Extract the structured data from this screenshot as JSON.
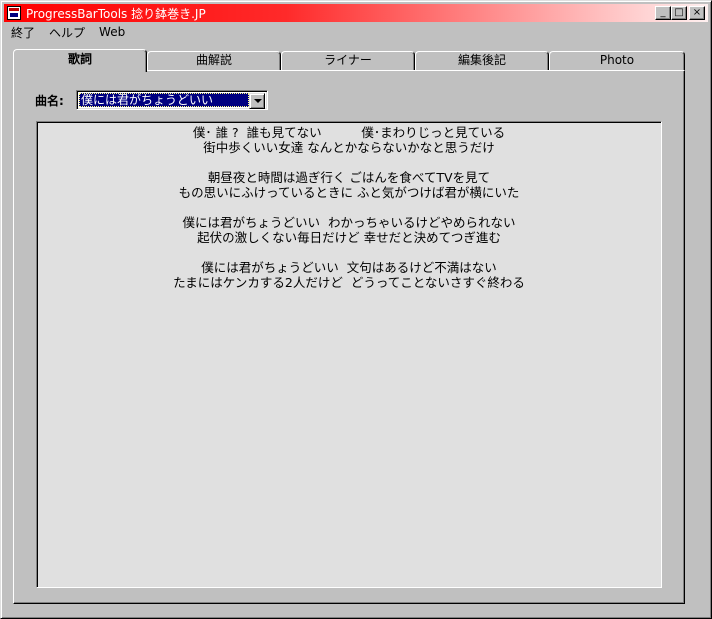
{
  "window": {
    "title": "ProgressBarTools  捻り鉢巻き.JP"
  },
  "title_buttons": {
    "minimize": "_",
    "maximize": "□",
    "close": "×"
  },
  "menu": [
    "終了",
    "ヘルプ",
    "Web"
  ],
  "tabs": [
    "歌詞",
    "曲解説",
    "ライナー",
    "編集後記",
    "Photo"
  ],
  "song": {
    "label": "曲名:",
    "selected": "僕には君がちょうどいい"
  },
  "lyrics": [
    "僕･ 誰 ?  誰も見てない          僕･まわりじっと見ている",
    "街中歩くいい女達 なんとかならないかなと思うだけ",
    "",
    "朝昼夜と時間は過ぎ行く ごはんを食べてTVを見て",
    "もの思いにふけっているときに ふと気がつけば君が横にいた",
    "",
    "僕には君がちょうどいい  わかっちゃいるけどやめられない",
    "起伏の激しくない毎日だけど 幸せだと決めてつぎ進む",
    "",
    "僕には君がちょうどいい  文句はあるけど不満はない",
    "たまにはケンカする2人だけど  どうってことないさすぐ終わる"
  ]
}
